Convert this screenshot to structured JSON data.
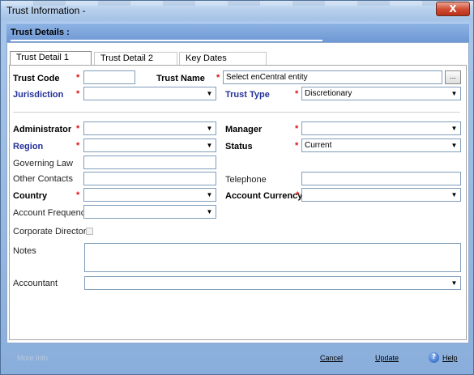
{
  "window": {
    "title": "Trust Information -",
    "close_symbol": "X"
  },
  "header": {
    "label": "Trust Details  :"
  },
  "tabs": [
    {
      "label": "Trust Detail 1",
      "active": true
    },
    {
      "label": "Trust Detail 2",
      "active": false
    },
    {
      "label": "Key Dates",
      "active": false
    }
  ],
  "required_marker": "*",
  "form": {
    "trust_code": {
      "label": "Trust Code",
      "value": ""
    },
    "trust_name": {
      "label": "Trust Name",
      "value": "Select enCentral entity",
      "button": "..."
    },
    "jurisdiction": {
      "label": "Jurisdiction",
      "value": ""
    },
    "trust_type": {
      "label": "Trust Type",
      "value": "Discretionary"
    },
    "administrator": {
      "label": "Administrator",
      "value": ""
    },
    "manager": {
      "label": "Manager",
      "value": ""
    },
    "region": {
      "label": "Region",
      "value": ""
    },
    "status": {
      "label": "Status",
      "value": "Current"
    },
    "governing_law": {
      "label": "Governing Law",
      "value": ""
    },
    "other_contacts": {
      "label": "Other Contacts",
      "value": ""
    },
    "telephone": {
      "label": "Telephone",
      "value": ""
    },
    "country": {
      "label": "Country",
      "value": ""
    },
    "account_currency": {
      "label": "Account Currency",
      "value": ""
    },
    "account_frequency": {
      "label": "Account Frequency",
      "value": ""
    },
    "corporate_director": {
      "label": "Corporate Director",
      "checked": false
    },
    "notes": {
      "label": "Notes",
      "value": ""
    },
    "accountant": {
      "label": "Accountant",
      "value": ""
    }
  },
  "footer": {
    "more_info": "More Info",
    "cancel": "Cancel",
    "update": "Update",
    "help": "Help"
  },
  "colors": {
    "label_blue": "#24319a",
    "required_red": "#dd1111",
    "header_band": "#7aa3db"
  }
}
